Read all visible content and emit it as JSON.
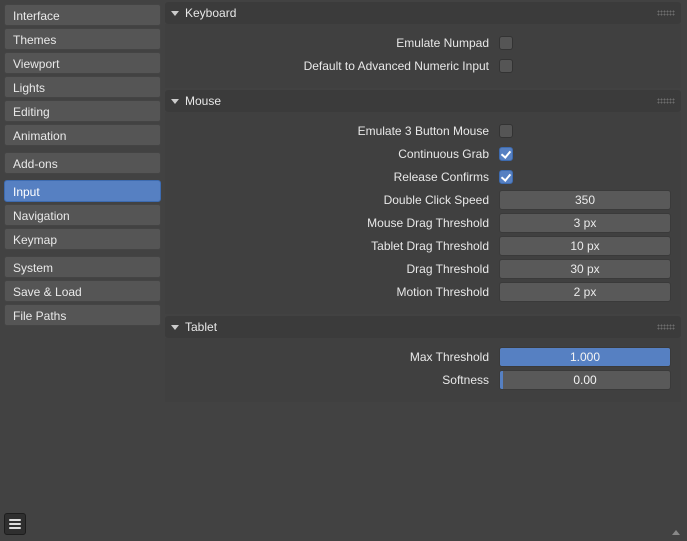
{
  "sidebar": {
    "groups": [
      {
        "items": [
          {
            "label": "Interface"
          },
          {
            "label": "Themes"
          },
          {
            "label": "Viewport"
          },
          {
            "label": "Lights"
          },
          {
            "label": "Editing"
          },
          {
            "label": "Animation"
          }
        ]
      },
      {
        "items": [
          {
            "label": "Add-ons"
          }
        ]
      },
      {
        "items": [
          {
            "label": "Input"
          },
          {
            "label": "Navigation"
          },
          {
            "label": "Keymap"
          }
        ]
      },
      {
        "items": [
          {
            "label": "System"
          },
          {
            "label": "Save & Load"
          },
          {
            "label": "File Paths"
          }
        ]
      }
    ],
    "active": "Input"
  },
  "sections": {
    "keyboard": {
      "title": "Keyboard",
      "emulate_numpad": {
        "label": "Emulate Numpad",
        "checked": false
      },
      "advanced_numeric": {
        "label": "Default to Advanced Numeric Input",
        "checked": false
      }
    },
    "mouse": {
      "title": "Mouse",
      "emulate_3btn": {
        "label": "Emulate 3 Button Mouse",
        "checked": false
      },
      "continuous_grab": {
        "label": "Continuous Grab",
        "checked": true
      },
      "release_confirms": {
        "label": "Release Confirms",
        "checked": true
      },
      "double_click_speed": {
        "label": "Double Click Speed",
        "value": "350"
      },
      "mouse_drag_threshold": {
        "label": "Mouse Drag Threshold",
        "value": "3 px"
      },
      "tablet_drag_threshold": {
        "label": "Tablet Drag Threshold",
        "value": "10 px"
      },
      "drag_threshold": {
        "label": "Drag Threshold",
        "value": "30 px"
      },
      "motion_threshold": {
        "label": "Motion Threshold",
        "value": "2 px"
      }
    },
    "tablet": {
      "title": "Tablet",
      "max_threshold": {
        "label": "Max Threshold",
        "value": "1.000",
        "fill": 1.0
      },
      "softness": {
        "label": "Softness",
        "value": "0.00",
        "fill": 0.0
      }
    }
  }
}
